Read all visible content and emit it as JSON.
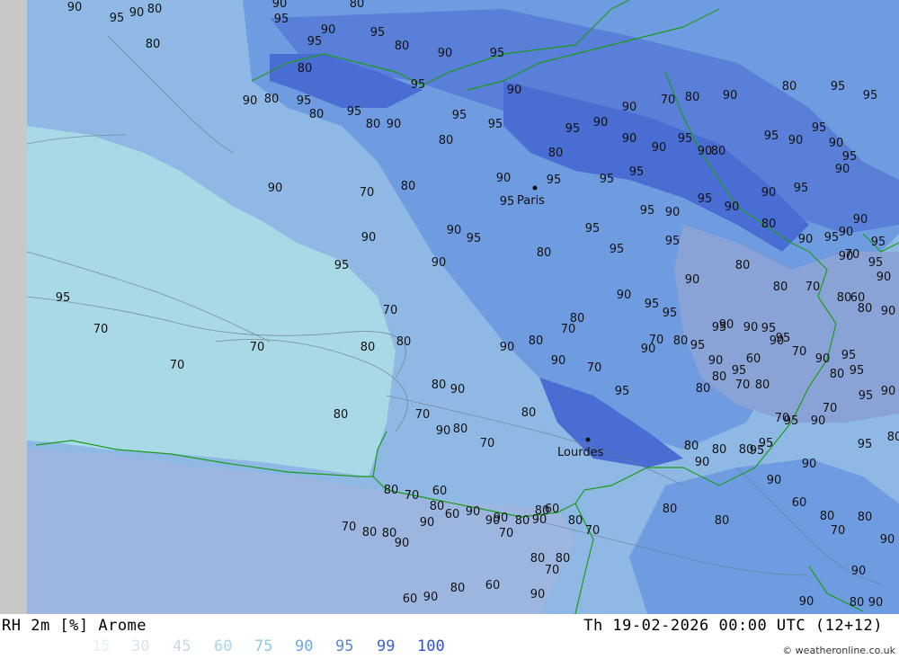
{
  "footer": {
    "title": "RH 2m [%] Arome",
    "valid_time": "Th 19-02-2026 00:00 UTC (12+12)",
    "credit": "© weatheronline.co.uk"
  },
  "legend": [
    {
      "label": "15",
      "color": "#e6eef6"
    },
    {
      "label": "30",
      "color": "#d6e3ee"
    },
    {
      "label": "45",
      "color": "#c7d8e8"
    },
    {
      "label": "60",
      "color": "#a9d6ec"
    },
    {
      "label": "75",
      "color": "#8ec8e8"
    },
    {
      "label": "90",
      "color": "#6fa8e0"
    },
    {
      "label": "95",
      "color": "#5a86d8"
    },
    {
      "label": "99",
      "color": "#3f63cf"
    },
    {
      "label": "100",
      "color": "#2f4fd0"
    }
  ],
  "cities": [
    "Paris",
    "Lourdes"
  ],
  "contour_labels": [
    "90",
    "95",
    "90",
    "80",
    "90",
    "95",
    "80",
    "90",
    "95",
    "80",
    "95",
    "80",
    "90",
    "95",
    "80",
    "95",
    "90",
    "80",
    "95",
    "80",
    "95",
    "80",
    "90",
    "95",
    "80",
    "90",
    "95",
    "95",
    "90",
    "90",
    "70",
    "80",
    "90",
    "80",
    "95",
    "95",
    "95",
    "90",
    "95",
    "90",
    "95",
    "90",
    "80",
    "90",
    "95",
    "90",
    "90",
    "80",
    "95",
    "95",
    "95",
    "90",
    "95",
    "90",
    "70",
    "80",
    "90",
    "95",
    "90",
    "90",
    "95",
    "80",
    "95",
    "95",
    "95",
    "90",
    "95",
    "95",
    "90",
    "90",
    "95",
    "80",
    "90",
    "95",
    "90",
    "90",
    "95",
    "90",
    "90",
    "80",
    "90",
    "95",
    "90",
    "95",
    "95",
    "90",
    "95",
    "95",
    "90",
    "95",
    "80",
    "95",
    "90",
    "95",
    "95",
    "90",
    "80",
    "95",
    "95",
    "90",
    "95",
    "70",
    "70",
    "70",
    "70",
    "80",
    "80",
    "80",
    "70",
    "80",
    "90",
    "90",
    "80",
    "70",
    "80",
    "90",
    "80",
    "90",
    "70",
    "80",
    "70",
    "95",
    "90",
    "70",
    "80",
    "95",
    "90",
    "80",
    "70",
    "80",
    "60",
    "80",
    "90",
    "70",
    "95",
    "90",
    "70",
    "60",
    "80",
    "90",
    "95",
    "80",
    "70",
    "80",
    "80",
    "90",
    "80",
    "80",
    "95",
    "70",
    "70",
    "90",
    "60",
    "80",
    "70",
    "80",
    "90",
    "90",
    "80",
    "90",
    "90",
    "80",
    "80",
    "70",
    "80",
    "90",
    "80",
    "90",
    "70",
    "80",
    "80",
    "70",
    "90",
    "60",
    "80",
    "90",
    "60",
    "80",
    "90",
    "80",
    "70",
    "80",
    "70",
    "60",
    "90",
    "80",
    "60",
    "90",
    "90",
    "80",
    "60",
    "90",
    "80",
    "80",
    "70",
    "90",
    "70",
    "70",
    "60",
    "80",
    "70"
  ]
}
